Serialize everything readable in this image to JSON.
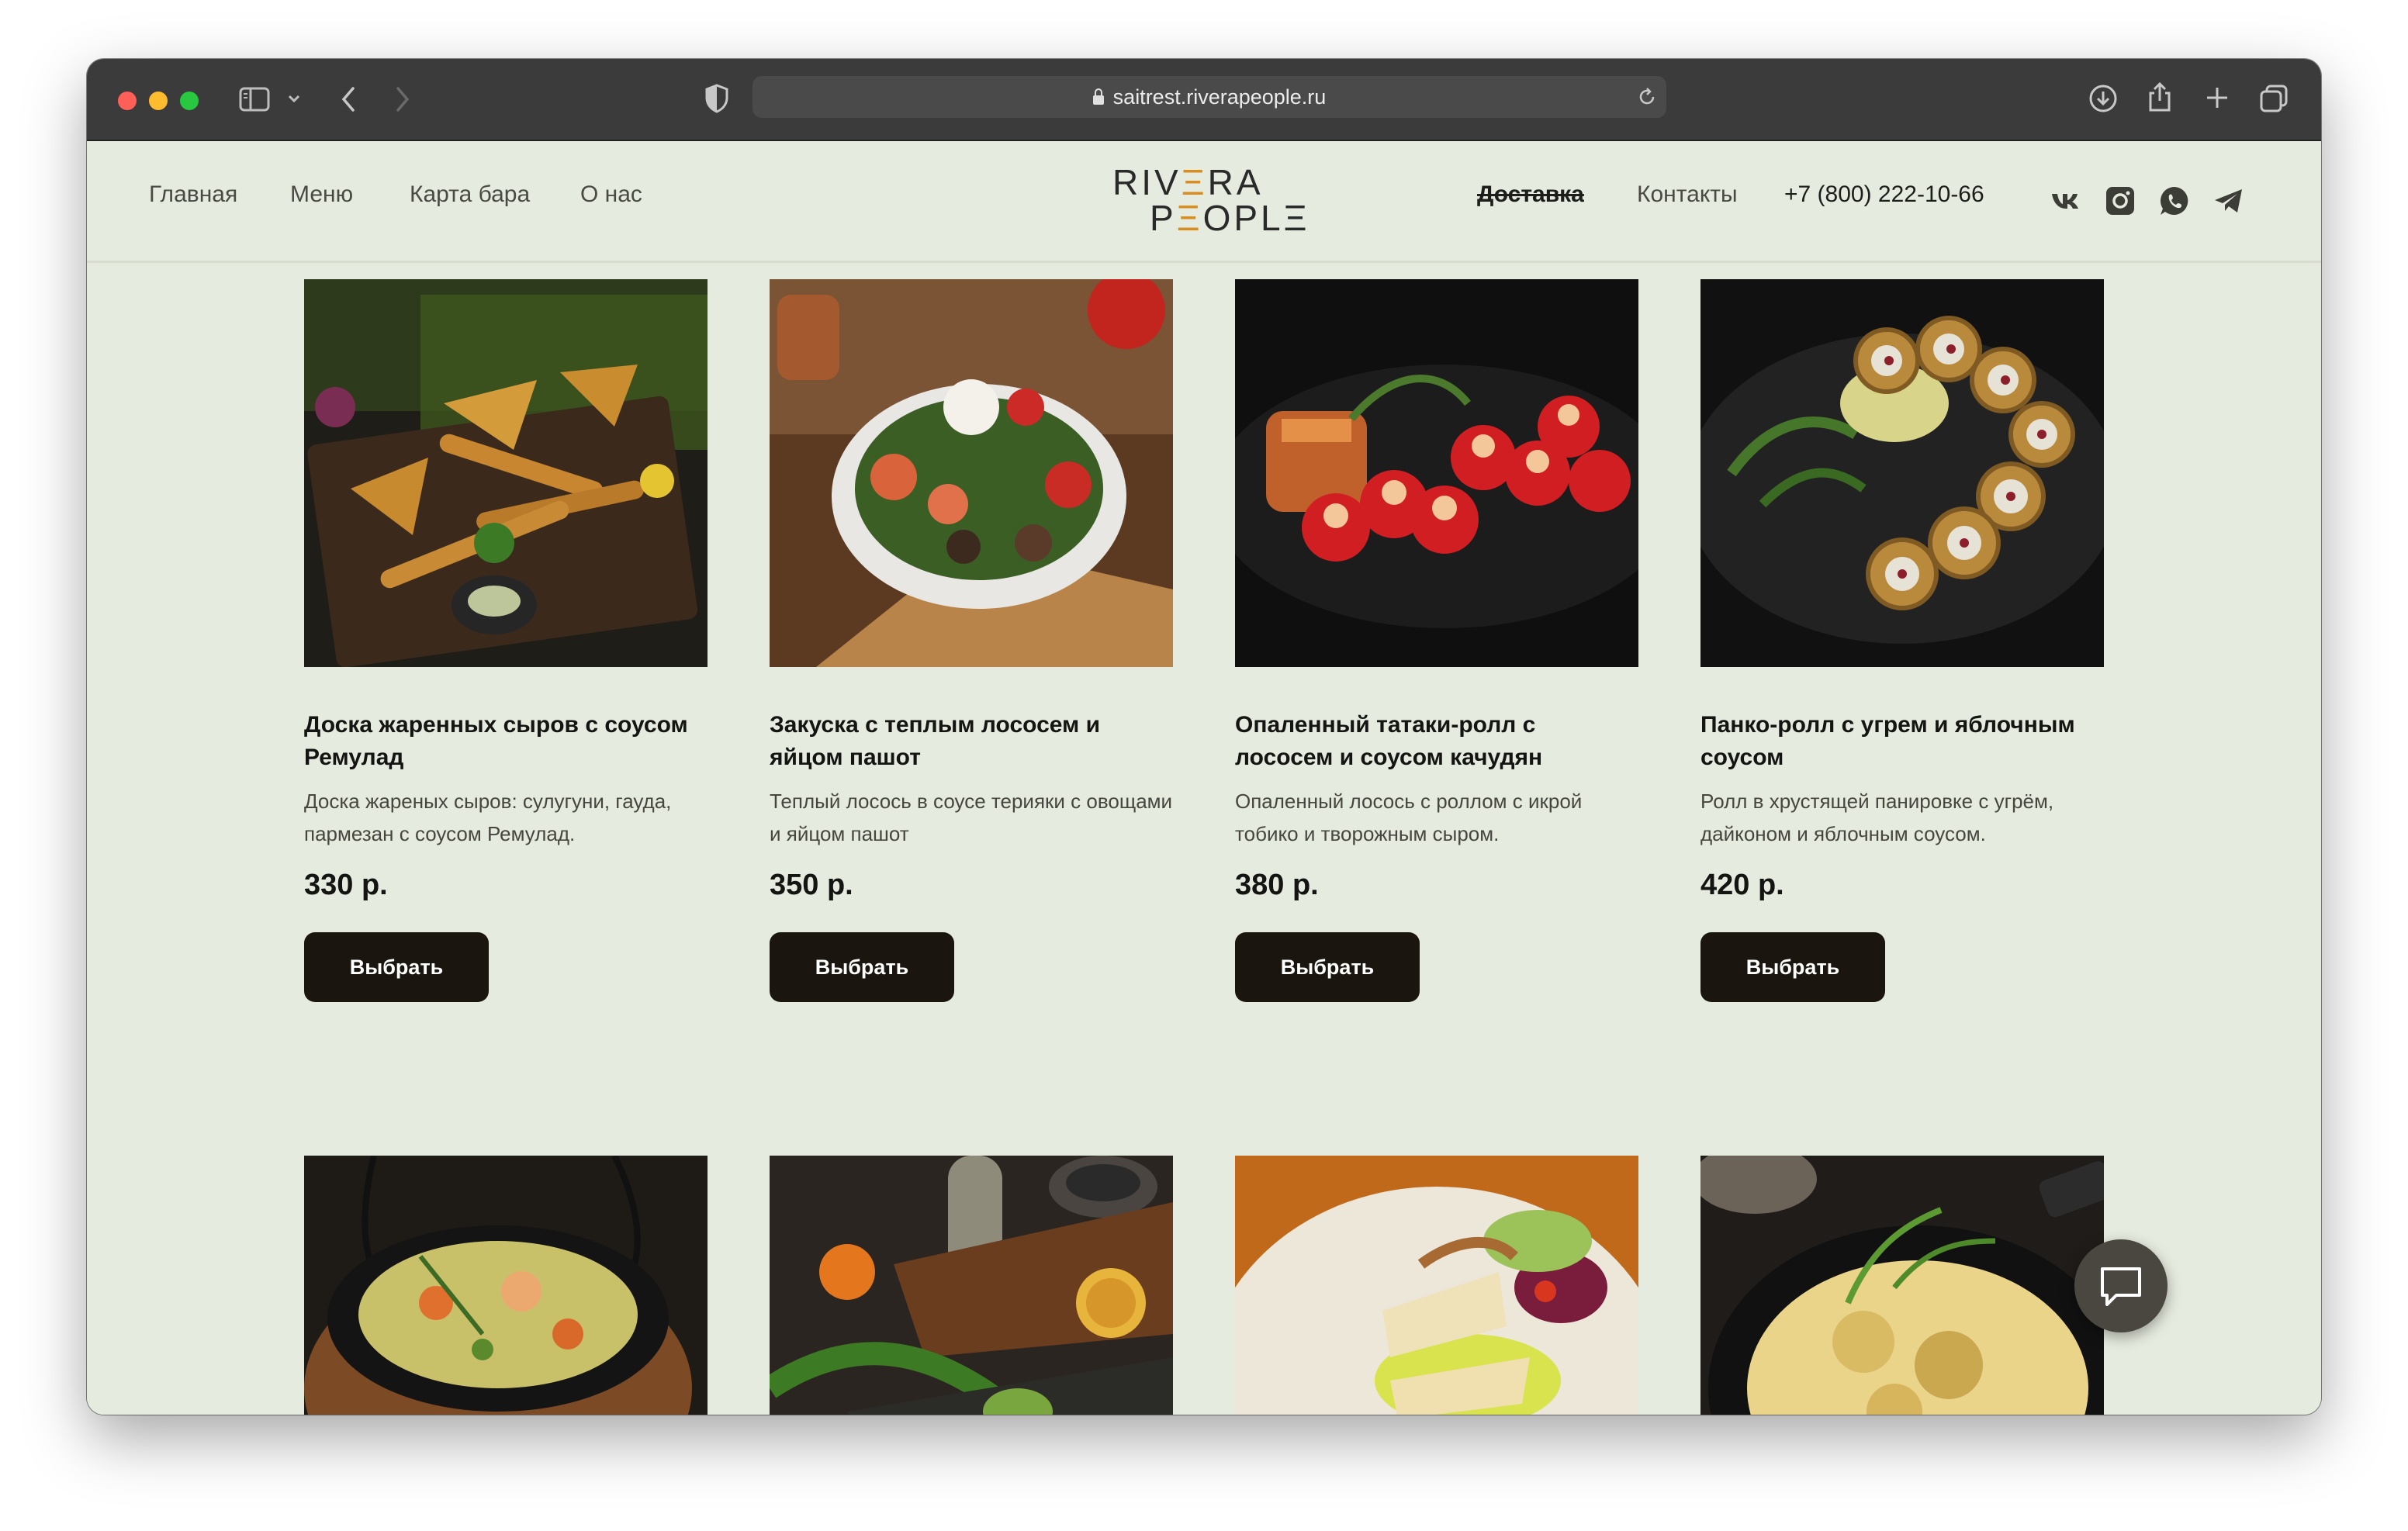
{
  "browser": {
    "url": "saitrest.riverapeople.ru"
  },
  "site": {
    "nav_left": [
      "Главная",
      "Меню",
      "Карта бара",
      "О нас"
    ],
    "logo": {
      "line1_a": "RIV",
      "line1_accent": "Ξ",
      "line1_b": "RA",
      "line2_a": "P",
      "line2_accent": "Ξ",
      "line2_b": "OPLΞ"
    },
    "nav_right": {
      "delivery": "Доставка",
      "contacts": "Контакты",
      "phone": "+7 (800) 222-10-66"
    },
    "social_icons": [
      "vk-icon",
      "instagram-icon",
      "whatsapp-icon",
      "telegram-icon"
    ]
  },
  "products": [
    {
      "title": "Доска жаренных сыров с соусом Ремулад",
      "description": "Доска жареных сыров: сулугуни, гауда, пармезан с соусом Ремулад.",
      "price": "330 р.",
      "button": "Выбрать"
    },
    {
      "title": "Закуска с теплым лососем и яйцом пашот",
      "description": "Теплый лосось в соусе терияки с овощами и яйцом пашот",
      "price": "350 р.",
      "button": "Выбрать"
    },
    {
      "title": "Опаленный татаки-ролл с лососем и соусом качудян",
      "description": "Опаленный лосось с роллом с икрой тобико и творожным сыром.",
      "price": "380 р.",
      "button": "Выбрать"
    },
    {
      "title": "Панко-ролл с угрем и яблочным соусом",
      "description": "Ролл в хрустящей панировке с угрём, дайконом и яблочным соусом.",
      "price": "420 р.",
      "button": "Выбрать"
    }
  ],
  "colors": {
    "page_bg": "#e6ebdf",
    "button_bg": "#1b1510",
    "logo_accent": "#d98d1e"
  }
}
